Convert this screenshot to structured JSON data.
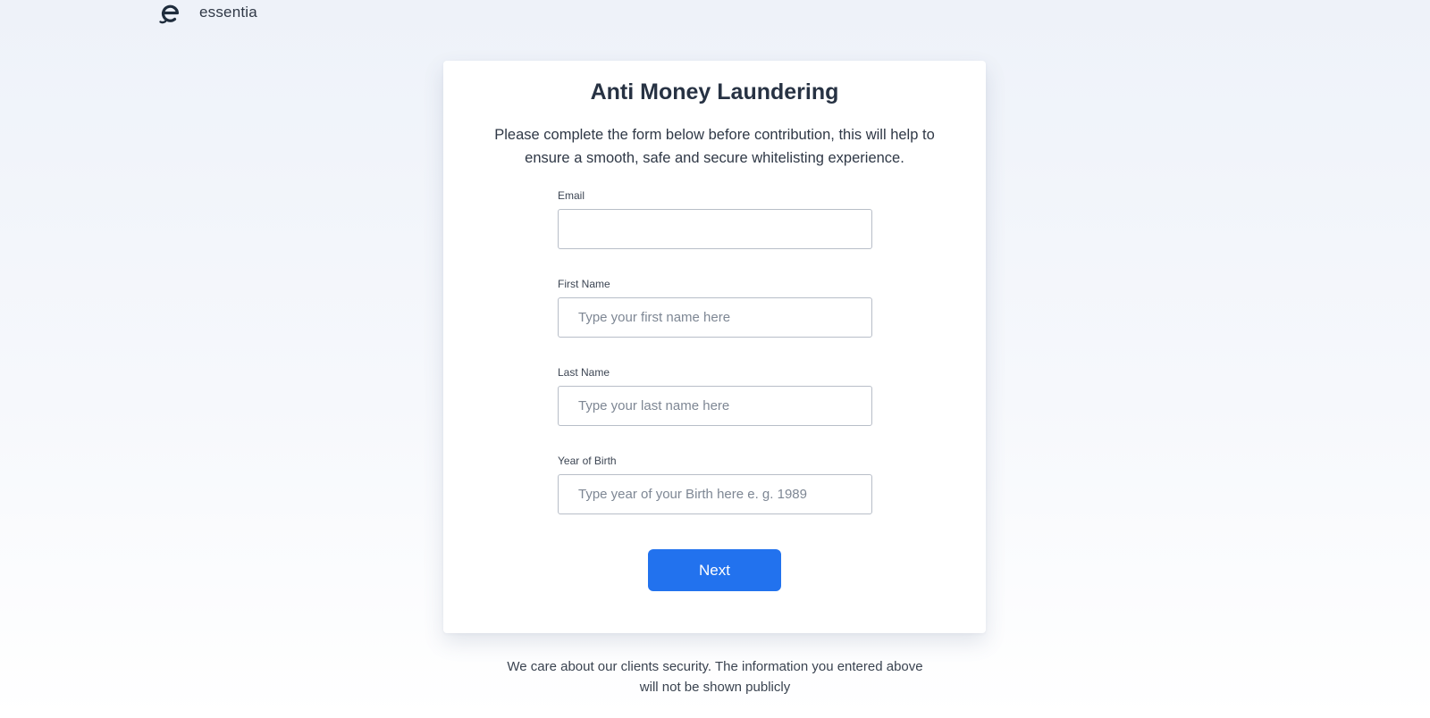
{
  "brand": {
    "logo_icon": "essentia-e-logo-icon",
    "name": "essentia",
    "color": "#1f2d3d"
  },
  "form": {
    "title": "Anti Money Laundering",
    "subtitle": "Please complete the form below before contribution, this will help to ensure a smooth, safe and secure whitelisting experience.",
    "fields": {
      "email": {
        "label": "Email",
        "value": "",
        "placeholder": ""
      },
      "first_name": {
        "label": "First Name",
        "value": "",
        "placeholder": "Type your first name here"
      },
      "last_name": {
        "label": "Last Name",
        "value": "",
        "placeholder": "Type your last name here"
      },
      "year_of_birth": {
        "label": "Year of Birth",
        "value": "",
        "placeholder": "Type year of your Birth here e. g. 1989"
      }
    },
    "next_label": "Next"
  },
  "footer": {
    "note": "We care about our clients security. The information you entered above will not be shown publicly"
  },
  "colors": {
    "accent": "#2272ee",
    "card_background": "#ffffff",
    "text": "#2b3441"
  }
}
